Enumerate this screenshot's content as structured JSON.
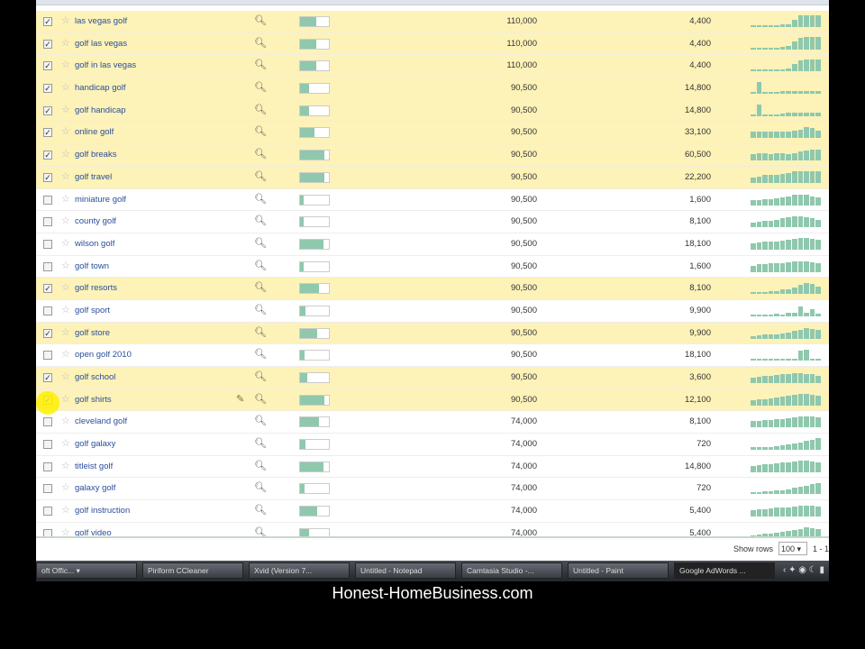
{
  "rows": [
    {
      "kw": "las vegas golf",
      "checked": true,
      "comp": 0.55,
      "global": "110,000",
      "local": "4,400",
      "trend": [
        15,
        10,
        15,
        15,
        15,
        20,
        25,
        60,
        90,
        95,
        95,
        95
      ]
    },
    {
      "kw": "golf las vegas",
      "checked": true,
      "comp": 0.55,
      "global": "110,000",
      "local": "4,400",
      "trend": [
        15,
        10,
        15,
        15,
        15,
        20,
        25,
        60,
        90,
        95,
        95,
        95
      ]
    },
    {
      "kw": "golf in las vegas",
      "checked": true,
      "comp": 0.55,
      "global": "110,000",
      "local": "4,400",
      "trend": [
        15,
        10,
        15,
        15,
        15,
        20,
        25,
        60,
        90,
        95,
        95,
        95
      ]
    },
    {
      "kw": "handicap golf",
      "checked": true,
      "comp": 0.3,
      "global": "90,500",
      "local": "14,800",
      "trend": [
        10,
        90,
        10,
        5,
        5,
        20,
        25,
        25,
        25,
        25,
        25,
        25
      ]
    },
    {
      "kw": "golf handicap",
      "checked": true,
      "comp": 0.3,
      "global": "90,500",
      "local": "14,800",
      "trend": [
        10,
        90,
        10,
        5,
        5,
        20,
        25,
        25,
        25,
        25,
        25,
        25
      ]
    },
    {
      "kw": "online golf",
      "checked": true,
      "comp": 0.5,
      "global": "90,500",
      "local": "33,100",
      "trend": [
        50,
        50,
        50,
        50,
        50,
        50,
        55,
        60,
        70,
        90,
        80,
        60
      ]
    },
    {
      "kw": "golf breaks",
      "checked": true,
      "comp": 0.85,
      "global": "90,500",
      "local": "60,500",
      "trend": [
        50,
        60,
        60,
        50,
        60,
        60,
        50,
        60,
        70,
        80,
        90,
        90
      ]
    },
    {
      "kw": "golf travel",
      "checked": true,
      "comp": 0.85,
      "global": "90,500",
      "local": "22,200",
      "trend": [
        40,
        50,
        60,
        60,
        60,
        70,
        80,
        90,
        95,
        95,
        95,
        95
      ]
    },
    {
      "kw": "miniature golf",
      "checked": false,
      "comp": 0.12,
      "global": "90,500",
      "local": "1,600",
      "trend": [
        40,
        40,
        45,
        50,
        55,
        60,
        70,
        80,
        85,
        80,
        70,
        60
      ]
    },
    {
      "kw": "county golf",
      "checked": false,
      "comp": 0.12,
      "global": "90,500",
      "local": "8,100",
      "trend": [
        40,
        45,
        50,
        55,
        60,
        70,
        80,
        85,
        85,
        80,
        70,
        60
      ]
    },
    {
      "kw": "wilson golf",
      "checked": false,
      "comp": 0.8,
      "global": "90,500",
      "local": "18,100",
      "trend": [
        50,
        55,
        60,
        60,
        65,
        70,
        80,
        85,
        90,
        90,
        85,
        80
      ]
    },
    {
      "kw": "golf town",
      "checked": false,
      "comp": 0.12,
      "global": "90,500",
      "local": "1,600",
      "trend": [
        50,
        60,
        60,
        70,
        70,
        70,
        75,
        80,
        80,
        80,
        75,
        70
      ]
    },
    {
      "kw": "golf resorts",
      "checked": true,
      "comp": 0.65,
      "global": "90,500",
      "local": "8,100",
      "trend": [
        10,
        15,
        10,
        20,
        25,
        35,
        40,
        50,
        70,
        90,
        80,
        60
      ]
    },
    {
      "kw": "golf sport",
      "checked": false,
      "comp": 0.2,
      "global": "90,500",
      "local": "9,900",
      "trend": [
        10,
        10,
        10,
        15,
        20,
        15,
        25,
        30,
        80,
        30,
        60,
        20
      ]
    },
    {
      "kw": "golf store",
      "checked": true,
      "comp": 0.6,
      "global": "90,500",
      "local": "9,900",
      "trend": [
        20,
        25,
        30,
        30,
        35,
        40,
        50,
        60,
        70,
        80,
        75,
        70
      ]
    },
    {
      "kw": "open golf 2010",
      "checked": false,
      "comp": 0.15,
      "global": "90,500",
      "local": "18,100",
      "trend": [
        5,
        5,
        5,
        5,
        5,
        5,
        5,
        10,
        80,
        90,
        20,
        5
      ]
    },
    {
      "kw": "golf school",
      "checked": true,
      "comp": 0.25,
      "global": "90,500",
      "local": "3,600",
      "trend": [
        40,
        50,
        55,
        60,
        65,
        70,
        75,
        80,
        80,
        75,
        70,
        60
      ]
    },
    {
      "kw": "golf shirts",
      "checked": true,
      "comp": 0.85,
      "global": "90,500",
      "local": "12,100",
      "trend": [
        40,
        45,
        50,
        55,
        60,
        70,
        80,
        85,
        90,
        90,
        85,
        80
      ]
    },
    {
      "kw": "cleveland golf",
      "checked": false,
      "comp": 0.65,
      "global": "74,000",
      "local": "8,100",
      "trend": [
        50,
        55,
        60,
        60,
        65,
        70,
        75,
        80,
        85,
        90,
        85,
        80
      ]
    },
    {
      "kw": "golf galaxy",
      "checked": false,
      "comp": 0.2,
      "global": "74,000",
      "local": "720",
      "trend": [
        20,
        20,
        25,
        25,
        30,
        35,
        40,
        50,
        60,
        70,
        80,
        90
      ]
    },
    {
      "kw": "titleist golf",
      "checked": false,
      "comp": 0.8,
      "global": "74,000",
      "local": "14,800",
      "trend": [
        50,
        55,
        60,
        65,
        70,
        75,
        80,
        85,
        90,
        90,
        85,
        80
      ]
    },
    {
      "kw": "galaxy golf",
      "checked": false,
      "comp": 0.15,
      "global": "74,000",
      "local": "720",
      "trend": [
        20,
        20,
        25,
        25,
        30,
        35,
        40,
        50,
        60,
        70,
        80,
        90
      ]
    },
    {
      "kw": "golf instruction",
      "checked": false,
      "comp": 0.6,
      "global": "74,000",
      "local": "5,400",
      "trend": [
        50,
        55,
        60,
        65,
        70,
        70,
        75,
        80,
        85,
        90,
        85,
        80
      ]
    },
    {
      "kw": "golf video",
      "checked": false,
      "comp": 0.3,
      "global": "74,000",
      "local": "5,400",
      "trend": [
        30,
        35,
        40,
        45,
        50,
        55,
        60,
        70,
        80,
        90,
        85,
        80
      ]
    }
  ],
  "footer": {
    "show_rows_label": "Show rows",
    "rows_value": "100",
    "range": "1 - 1"
  },
  "taskbar": [
    "oft Offic... ▾",
    "Piriform CCleaner",
    "Xvid (Version 7...",
    "Untitled - Notepad",
    "Camtasia Studio -...",
    "Untitled - Paint",
    "Google AdWords ..."
  ],
  "tray": "‹ ✦ ◉ ☾ ▮",
  "brand": "Honest-HomeBusiness.com",
  "colors": {
    "selected_row": "#fdf2b8",
    "bar": "#8fc8ad",
    "link": "#2a4e9a"
  }
}
